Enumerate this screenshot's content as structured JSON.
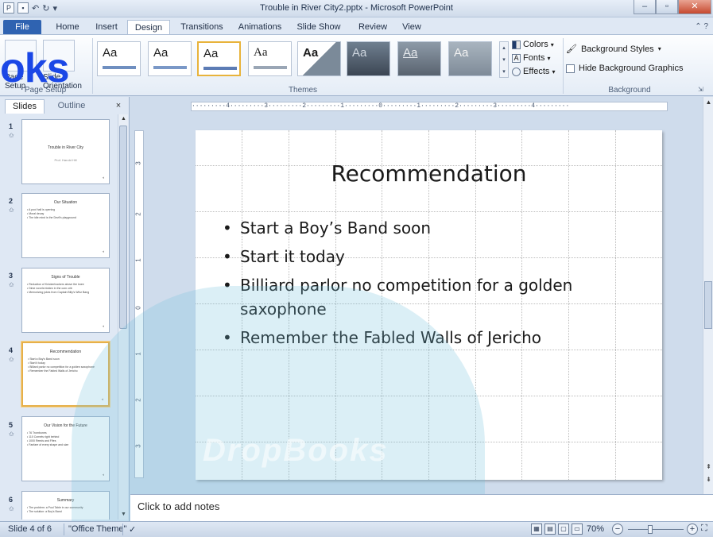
{
  "window": {
    "title": "Trouble in River City2.pptx - Microsoft PowerPoint"
  },
  "tabs": [
    {
      "label": "File"
    },
    {
      "label": "Home"
    },
    {
      "label": "Insert"
    },
    {
      "label": "Design"
    },
    {
      "label": "Transitions"
    },
    {
      "label": "Animations"
    },
    {
      "label": "Slide Show"
    },
    {
      "label": "Review"
    },
    {
      "label": "View"
    }
  ],
  "ribbon": {
    "page_setup": {
      "btn1": "Page Setup",
      "btn2": "Slide Orientation",
      "group": "Page Setup"
    },
    "themes_group": "Themes",
    "theme_sample": "Aa",
    "colors": "Colors",
    "fonts": "Fonts",
    "effects": "Effects",
    "background_styles": "Background Styles",
    "hide_background": "Hide Background Graphics",
    "background_group": "Background"
  },
  "watermark": {
    "overlay_text": "oks",
    "image_text": "DropBooks"
  },
  "panel": {
    "tab_slides": "Slides",
    "tab_outline": "Outline",
    "close": "×"
  },
  "thumbnails": [
    {
      "num": "1",
      "title": "Trouble in River City",
      "sub": "Prof. Harold Hill",
      "bullets": []
    },
    {
      "num": "2",
      "title": "Our Situation",
      "sub": "",
      "bullets": [
        "• A pool hall is opening",
        "• Moral decay",
        "• The idle mind is the Devil's playground"
      ]
    },
    {
      "num": "3",
      "title": "Signs of Trouble",
      "sub": "",
      "bullets": [
        "• Reduction of Knickerbockers above the knee",
        "• Dime novels hidden in the corn crib",
        "• Memorizing jokes from Captain Billy's Whiz Bang"
      ]
    },
    {
      "num": "4",
      "title": "Recommendation",
      "sub": "",
      "bullets": [
        "• Start a Boy's Band soon",
        "• Start it today",
        "• Billiard parlor no competition for a golden saxophone",
        "• Remember the Fabled Walls of Jericho"
      ]
    },
    {
      "num": "5",
      "title": "Our Vision for the Future",
      "sub": "",
      "bullets": [
        "• 76 Trombones",
        "• 110 Cornets right behind",
        "• 1000 Reeds and Fifes",
        "• Fanfare of every shape and size"
      ]
    },
    {
      "num": "6",
      "title": "Summary",
      "sub": "",
      "bullets": [
        "• The problem: a Pool Table in our community",
        "• The solution: a Boy's Band"
      ]
    }
  ],
  "slide": {
    "title": "Recommendation",
    "bullets": [
      "Start a Boy’s Band soon",
      "Start it today",
      "Billiard parlor no competition for a golden saxophone",
      "Remember the Fabled Walls of Jericho"
    ]
  },
  "ruler": {
    "horizontal": "·········4·········3·········2·········1·········0·········1·········2·········3·········4·········",
    "vertical_marks": [
      "3",
      "2",
      "1",
      "0",
      "1",
      "2",
      "3"
    ]
  },
  "notes": {
    "placeholder": "Click to add notes"
  },
  "status": {
    "slide_of": "Slide 4 of 6",
    "theme": "\"Office Theme\"",
    "zoom": "70%"
  },
  "colors": {
    "file_tab": "#2f63b1",
    "selected_thumb": "#e6b04a",
    "watermark_blue": "#1a47e6"
  }
}
